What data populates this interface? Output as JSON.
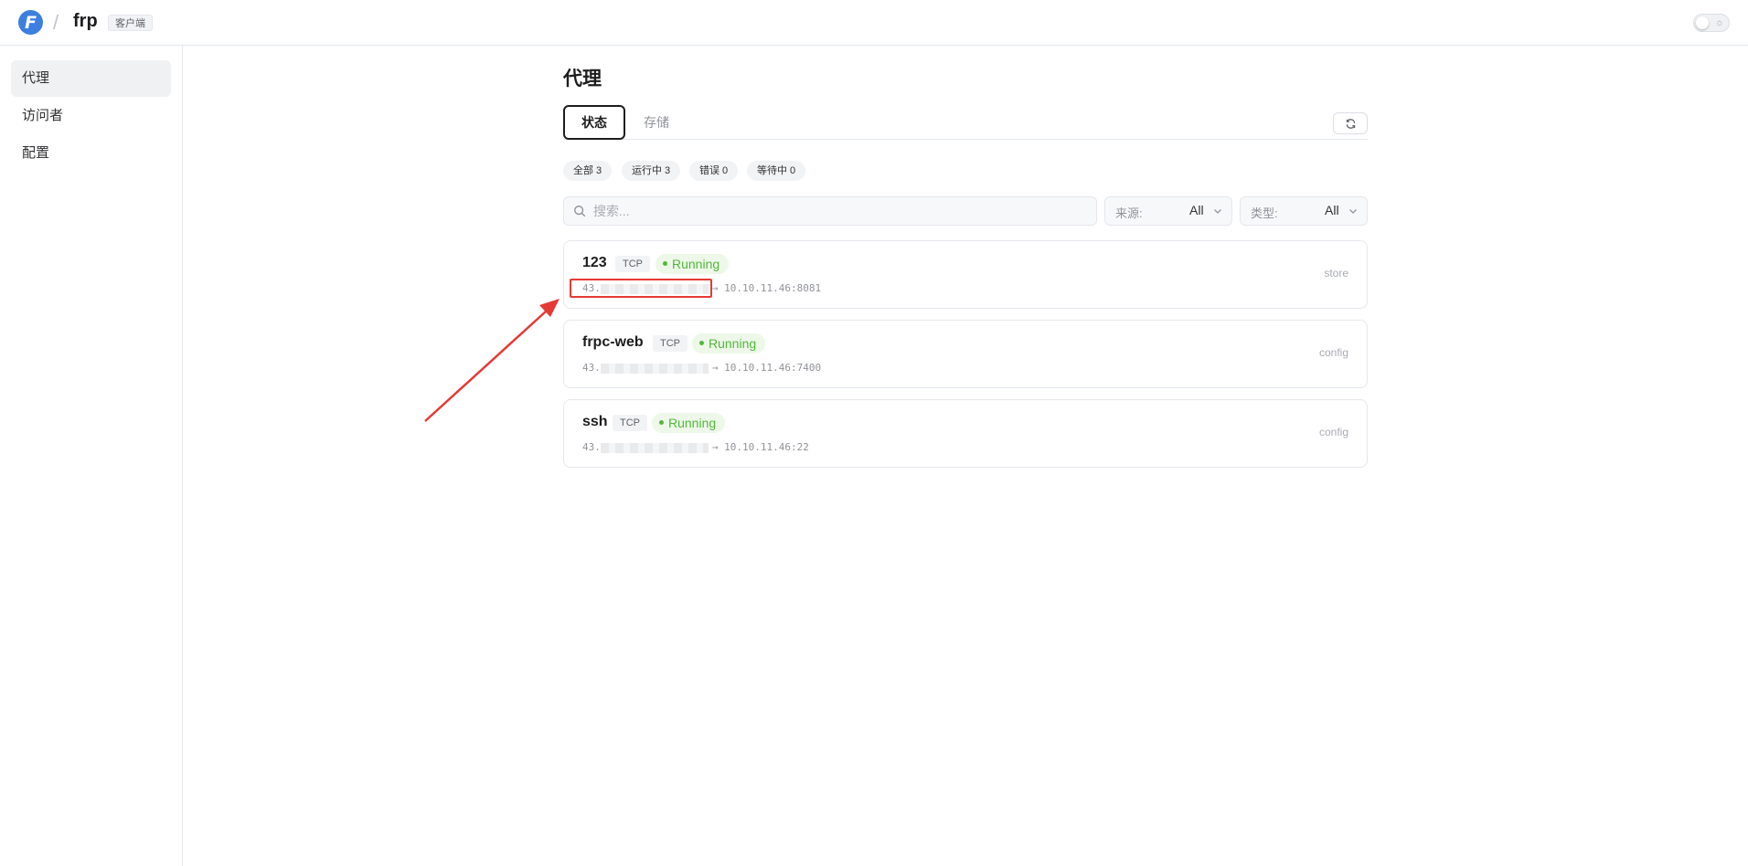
{
  "header": {
    "logo_letter": "F",
    "separator": "/",
    "app_name": "frp",
    "client_badge": "客户端"
  },
  "sidebar": {
    "items": [
      {
        "label": "代理",
        "active": true
      },
      {
        "label": "访问者",
        "active": false
      },
      {
        "label": "配置",
        "active": false
      }
    ]
  },
  "main": {
    "title": "代理",
    "tabs": [
      {
        "label": "状态",
        "active": true
      },
      {
        "label": "存储",
        "active": false
      }
    ],
    "chips": [
      "全部 3",
      "运行中 3",
      "错误 0",
      "等待中 0"
    ],
    "search": {
      "placeholder": "搜索..."
    },
    "filters": [
      {
        "label": "来源:",
        "value": "All"
      },
      {
        "label": "类型:",
        "value": "All"
      }
    ],
    "proxies": [
      {
        "name": "123",
        "type": "TCP",
        "status": "Running",
        "addr_prefix": "43.",
        "target": "→ 10.10.11.46:8081",
        "source": "store"
      },
      {
        "name": "frpc-web",
        "type": "TCP",
        "status": "Running",
        "addr_prefix": "43.",
        "target": "→ 10.10.11.46:7400",
        "source": "config"
      },
      {
        "name": "ssh",
        "type": "TCP",
        "status": "Running",
        "addr_prefix": "43.",
        "target": "→ 10.10.11.46:22",
        "source": "config"
      }
    ]
  },
  "colors": {
    "accent": "#3d7fe0",
    "running_green": "#52b839",
    "annotation_red": "#e53935"
  }
}
